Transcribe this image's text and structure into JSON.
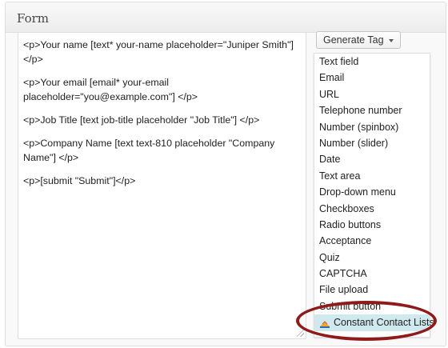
{
  "panel": {
    "title": "Form"
  },
  "editor": {
    "lines": [
      "<p>Your name [text* your-name placeholder=\"Juniper Smith\"] </p>",
      "<p>Your email [email* your-email placeholder=\"you@example.com\"] </p>",
      "<p>Job Title [text job-title placeholder \"Job Title\"] </p>",
      "<p>Company Name [text text-810 placeholder \"Company Name\"] </p>",
      "<p>[submit \"Submit\"]</p>"
    ]
  },
  "generate_tag": {
    "label": "Generate Tag",
    "icon": "chevron-down-icon"
  },
  "tag_menu": {
    "items": [
      "Text field",
      "Email",
      "URL",
      "Telephone number",
      "Number (spinbox)",
      "Number (slider)",
      "Date",
      "Text area",
      "Drop-down menu",
      "Checkboxes",
      "Radio buttons",
      "Acceptance",
      "Quiz",
      "CAPTCHA",
      "File upload",
      "Submit button",
      "Constant Contact Lists"
    ],
    "highlighted_item_icon": "constant-contact-icon",
    "highlight_color": "#cfe9ef"
  },
  "annotation": {
    "color": "#8e1a1a"
  }
}
